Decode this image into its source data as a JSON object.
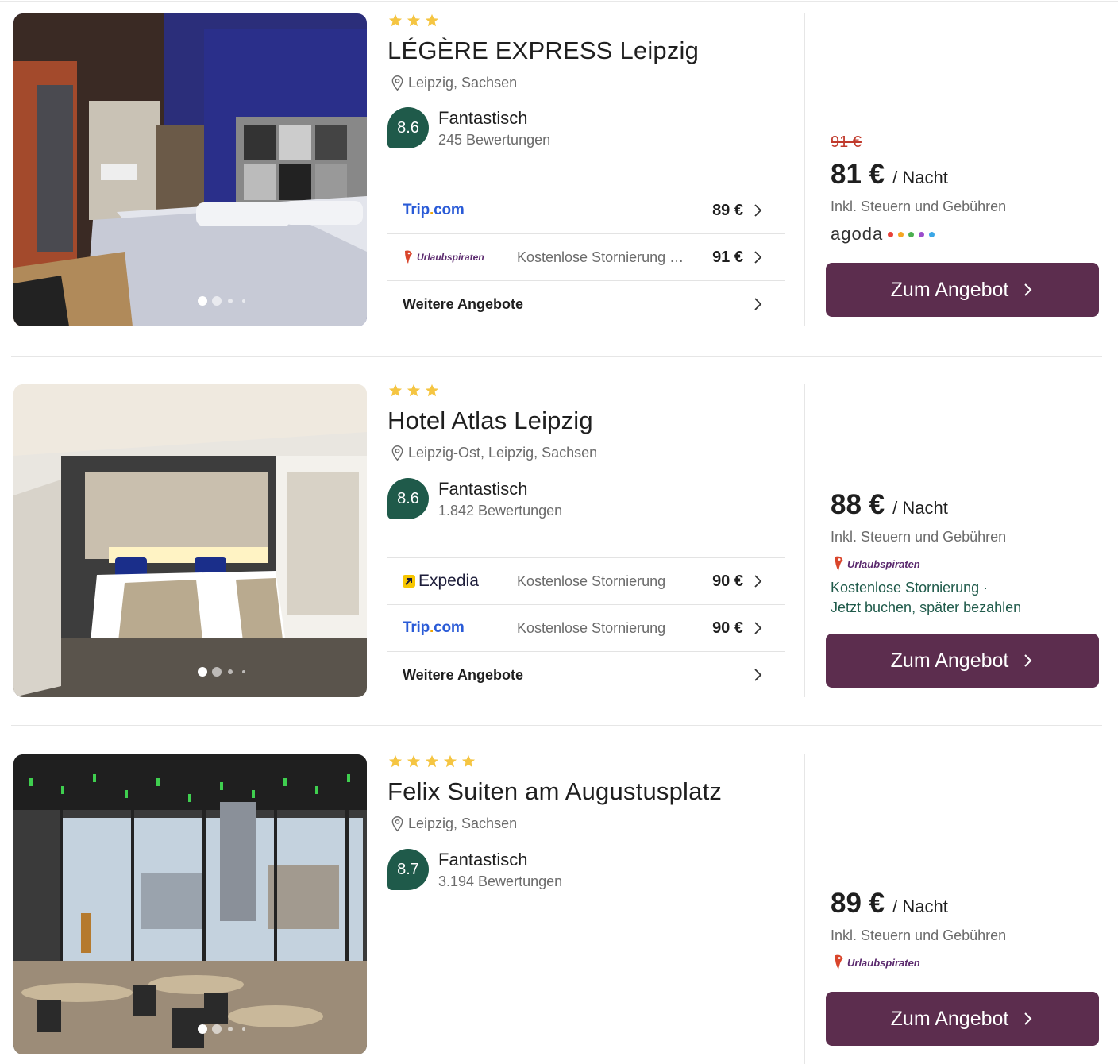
{
  "hotels": [
    {
      "stars": 3,
      "name": "LÉGÈRE EXPRESS Leipzig",
      "location": "Leipzig, Sachsen",
      "score": "8.6",
      "rating_label": "Fantastisch",
      "reviews": "245 Bewertungen",
      "offers": [
        {
          "provider": "Trip.com",
          "note": "",
          "price": "89 €"
        },
        {
          "provider": "Urlaubspiraten",
          "note": "Kostenlose Stornierung …",
          "price": "91 €"
        }
      ],
      "more_offers": "Weitere Angebote",
      "old_price": "91 €",
      "price": "81 €",
      "per": "/ Nacht",
      "incl": "Inkl. Steuern und Gebühren",
      "best_provider": "agoda",
      "cta": "Zum Angebot"
    },
    {
      "stars": 3,
      "name": "Hotel Atlas Leipzig",
      "location": "Leipzig-Ost, Leipzig, Sachsen",
      "score": "8.6",
      "rating_label": "Fantastisch",
      "reviews": "1.842 Bewertungen",
      "offers": [
        {
          "provider": "Expedia",
          "note": "Kostenlose Stornierung",
          "price": "90 €"
        },
        {
          "provider": "Trip.com",
          "note": "Kostenlose Stornierung",
          "price": "90 €"
        }
      ],
      "more_offers": "Weitere Angebote",
      "price": "88 €",
      "per": "/ Nacht",
      "incl": "Inkl. Steuern und Gebühren",
      "best_provider": "Urlaubspiraten",
      "note_line1": "Kostenlose Stornierung ·",
      "note_line2": "Jetzt buchen, später bezahlen",
      "cta": "Zum Angebot"
    },
    {
      "stars": 5,
      "name": "Felix Suiten am Augustusplatz",
      "location": "Leipzig, Sachsen",
      "score": "8.7",
      "rating_label": "Fantastisch",
      "reviews": "3.194 Bewertungen",
      "price": "89 €",
      "per": "/ Nacht",
      "incl": "Inkl. Steuern und Gebühren",
      "best_provider": "Urlaubspiraten",
      "cta": "Zum Angebot"
    }
  ],
  "colors": {
    "score_bg": "#1f5a4a",
    "cta_bg": "#5c2d4e",
    "star": "#f5c542",
    "old_price": "#c0392b",
    "trip_blue": "#2a5bd7"
  }
}
